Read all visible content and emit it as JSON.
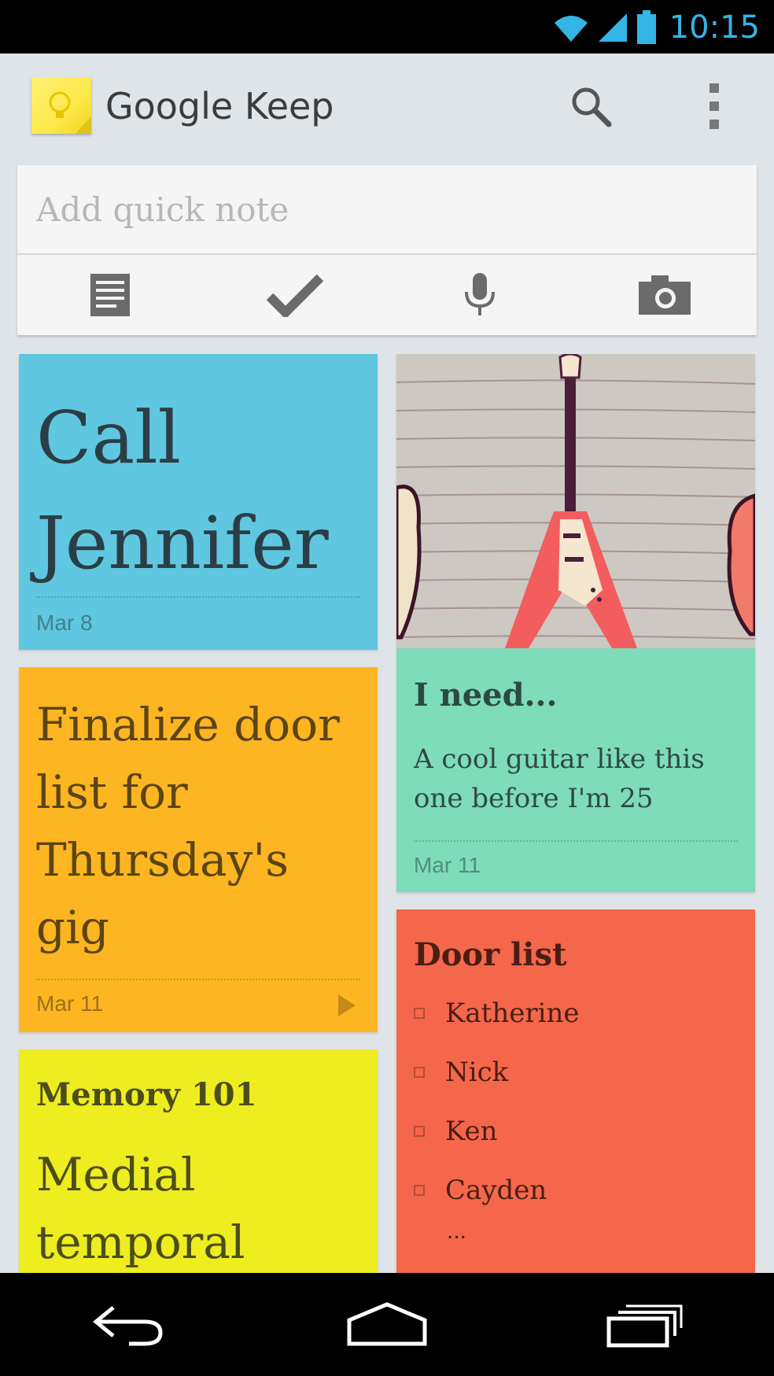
{
  "status": {
    "time": "10:15",
    "icons": [
      "wifi-icon",
      "signal-icon",
      "battery-icon"
    ]
  },
  "appbar": {
    "title": "Google Keep",
    "actions": [
      "search-icon",
      "overflow-menu-icon"
    ]
  },
  "quick_note": {
    "placeholder": "Add quick note",
    "tools": [
      "text-note-icon",
      "checklist-icon",
      "microphone-icon",
      "camera-icon"
    ]
  },
  "notes": {
    "call": {
      "title": "Call Jennifer",
      "date": "Mar 8"
    },
    "finalize": {
      "title": "Finalize door list for Thursday's gig",
      "date": "Mar 11"
    },
    "memory": {
      "title": "Memory 101",
      "body": "Medial temporal"
    },
    "guitar": {
      "title": "I need...",
      "body": "A cool guitar like this one before I'm 25",
      "date": "Mar 11"
    },
    "door": {
      "title": "Door list",
      "items": [
        "Katherine",
        "Nick",
        "Ken",
        "Cayden"
      ],
      "more": "..."
    }
  },
  "colors": {
    "blue": "#5fc7df",
    "orange": "#fdb521",
    "yellow": "#eded20",
    "green": "#7edcbb",
    "red": "#f4674a",
    "accent": "#33b5e5"
  },
  "navbar": [
    "back-icon",
    "home-icon",
    "recents-icon"
  ]
}
